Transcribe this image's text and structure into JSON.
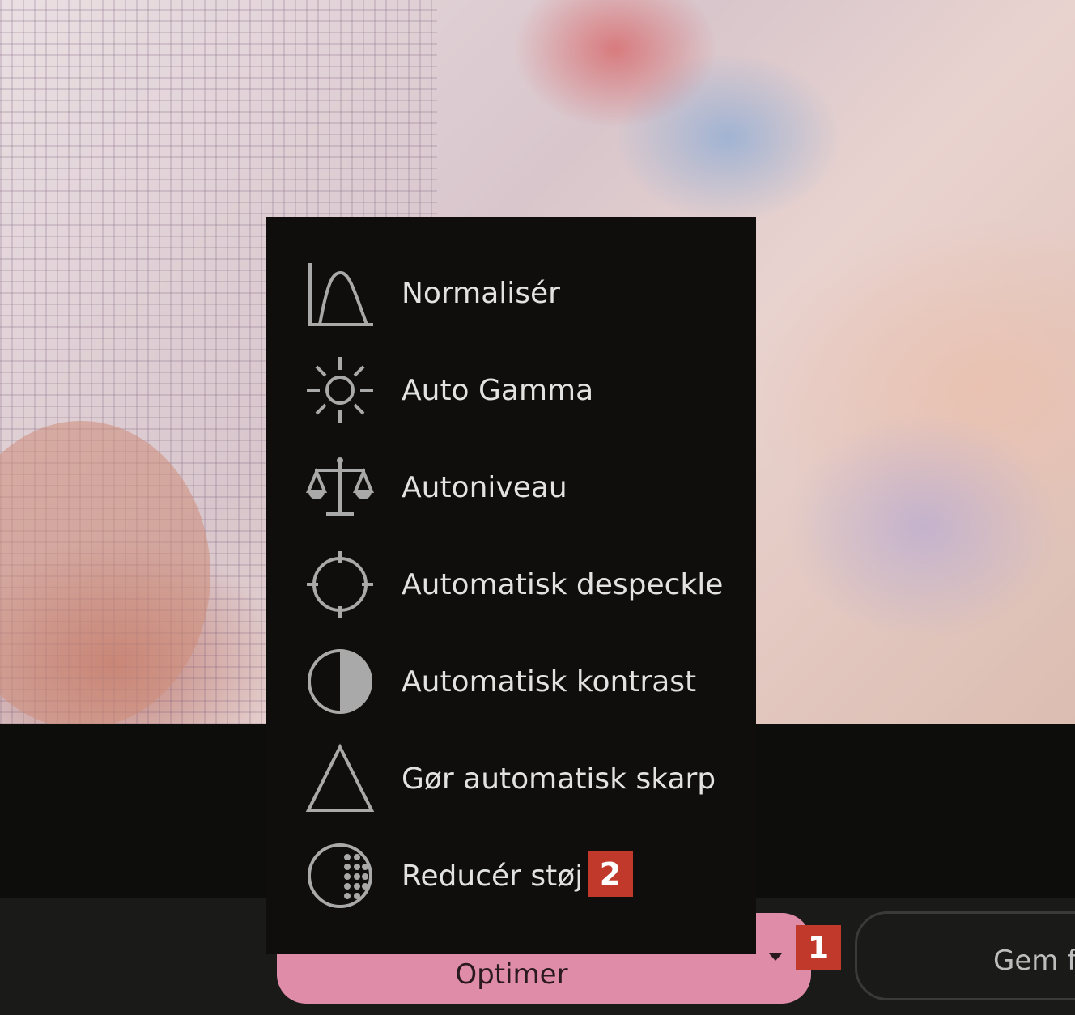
{
  "menu": {
    "items": [
      {
        "label": "Normalisér",
        "icon": "histogram-icon"
      },
      {
        "label": "Auto Gamma",
        "icon": "sun-icon"
      },
      {
        "label": "Autoniveau",
        "icon": "scales-icon"
      },
      {
        "label": "Automatisk despeckle",
        "icon": "crosshair-icon"
      },
      {
        "label": "Automatisk kontrast",
        "icon": "contrast-icon"
      },
      {
        "label": "Gør automatisk skarp",
        "icon": "triangle-icon"
      },
      {
        "label": "Reducér støj",
        "icon": "noise-icon"
      }
    ]
  },
  "toolbar": {
    "optimize_label": "Optimer",
    "save_label": "Gem f"
  },
  "markers": {
    "one": "1",
    "two": "2"
  },
  "colors": {
    "menu_bg": "#0f0e0c",
    "menu_text": "#e2e2e2",
    "accent_button": "#df8ca9",
    "marker": "#c0392b"
  }
}
